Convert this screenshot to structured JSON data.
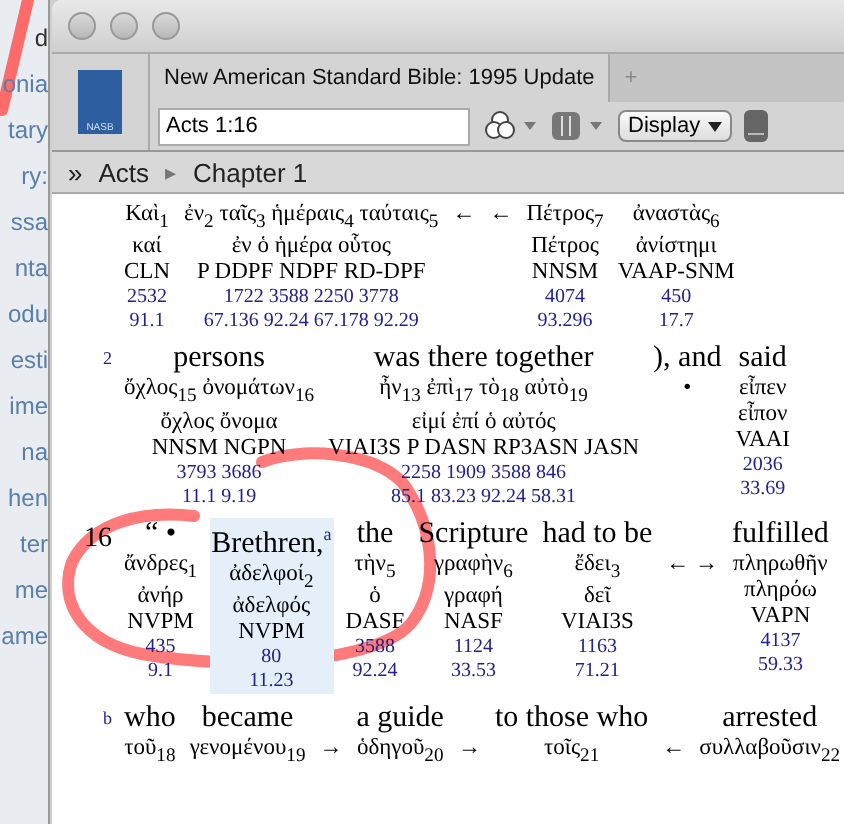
{
  "background_window": {
    "fragments": [
      "d",
      "onia",
      "tary",
      "ry:",
      "ssa",
      "nta",
      "odu",
      "esti",
      "ime",
      "na",
      "hen",
      "ter",
      "me",
      "ame"
    ]
  },
  "toolbar": {
    "logo_text": "NASB",
    "tabs": [
      {
        "label": "New American Standard Bible: 1995 Update",
        "selected": true
      },
      {
        "label": "+",
        "selected": false
      }
    ],
    "reference": "Acts 1:16",
    "display_button": "Display"
  },
  "breadcrumb": {
    "toggle": "»",
    "separator": "▸",
    "items": [
      "Acts",
      "Chapter 1"
    ]
  },
  "lines": [
    {
      "units": [
        {
          "kind": "word",
          "greek": "Καὶ$_{1}$",
          "lemma": "καί",
          "morph": "CLN",
          "strong": "2532",
          "louw": "91.1",
          "selected": false
        },
        {
          "kind": "word",
          "greek": "ἐν$_{2}$ ταῖς$_{3}$ ἡμέραις$_{4}$ ταύταις$_{5}$",
          "lemma": "ἐν ὁ ἡμέρα οὗτος",
          "morph": "P DDPF NDPF RD-DPF",
          "strong": "1722 3588 2250 3778",
          "louw": "67.136 92.24 67.178 92.29",
          "selected": false
        },
        {
          "kind": "arrow",
          "greek": "←"
        },
        {
          "kind": "arrow",
          "greek": "←"
        },
        {
          "kind": "word",
          "greek": "Πέτρος$_{7}$",
          "lemma": "Πέτρος",
          "morph": "NNSM",
          "strong": "4074",
          "louw": "93.296",
          "selected": false
        },
        {
          "kind": "word",
          "greek": "ἀναστὰς$_{6}$",
          "lemma": "ἀνίστημι",
          "morph": "VAAP-SNM",
          "strong": "450",
          "louw": "17.7",
          "selected": false
        }
      ]
    },
    {
      "marker": "2",
      "units": [
        {
          "kind": "word",
          "english": "persons",
          "greek": "ὄχλος$_{15}$ ὀνομάτων$_{16}$",
          "lemma": "ὄχλος ὄνομα",
          "morph": "NNSM NGPN",
          "strong": "3793 3686",
          "louw": "11.1 9.19",
          "selected": false
        },
        {
          "kind": "word",
          "english": "was there together",
          "greek": "ἦν$_{13}$ ἐπὶ$_{17}$ τὸ$_{18}$ αὐτὸ$_{19}$",
          "lemma": "εἰμί ἐπί ὁ αὐτός",
          "morph": "VIAI3S P DASN RP3ASN JASN",
          "strong": "2258 1909 3588 846",
          "louw": "85.1 83.23 92.24 58.31",
          "selected": false
        },
        {
          "kind": "arrow",
          "english": "), and",
          "greek": "•"
        },
        {
          "kind": "word",
          "english": "said",
          "greek": "εἶπεν",
          "lemma": "εἶπον",
          "morph": "VAAI",
          "strong": "2036",
          "louw": "33.69",
          "selected": false
        }
      ]
    },
    {
      "marker": "16",
      "units": [
        {
          "kind": "word",
          "english": "“ •",
          "greek": "ἄνδρες$_{1}$",
          "lemma": "ἀνήρ",
          "morph": "NVPM",
          "strong": "435",
          "louw": "9.1",
          "selected": false
        },
        {
          "kind": "word",
          "english": "Brethren,",
          "note": "a",
          "greek": "ἀδελφοί$_{2}$",
          "lemma": "ἀδελφός",
          "morph": "NVPM",
          "strong": "80",
          "louw": "11.23",
          "selected": true
        },
        {
          "kind": "word",
          "english": "the",
          "greek": "τὴν$_{5}$",
          "lemma": "ὁ",
          "morph": "DASF",
          "strong": "3588",
          "louw": "92.24",
          "selected": false
        },
        {
          "kind": "word",
          "english": "Scripture",
          "greek": "γραφὴν$_{6}$",
          "lemma": "γραφή",
          "morph": "NASF",
          "strong": "1124",
          "louw": "33.53",
          "selected": false
        },
        {
          "kind": "word",
          "english": "had to be",
          "greek": "ἔδει$_{3}$",
          "lemma": "δεῖ",
          "morph": "VIAI3S",
          "strong": "1163",
          "louw": "71.21",
          "selected": false
        },
        {
          "kind": "arrow",
          "greek": "← →"
        },
        {
          "kind": "word",
          "english": "fulfilled",
          "greek": "πληρωθῆν",
          "lemma": "πληρόω",
          "morph": "VAPN",
          "strong": "4137",
          "louw": "59.33",
          "selected": false
        }
      ]
    },
    {
      "marker": "b",
      "units": [
        {
          "kind": "word",
          "english": "who",
          "greek": "τοῦ$_{18}$",
          "selected": false
        },
        {
          "kind": "word",
          "english": "became",
          "greek": "γενομένου$_{19}$",
          "selected": false
        },
        {
          "kind": "arrow",
          "greek": "→"
        },
        {
          "kind": "word",
          "english": "a guide",
          "greek": "ὁδηγοῦ$_{20}$",
          "selected": false
        },
        {
          "kind": "arrow",
          "greek": "→"
        },
        {
          "kind": "word",
          "english": "to those who",
          "greek": "τοῖς$_{21}$",
          "selected": false
        },
        {
          "kind": "arrow",
          "greek": "←"
        },
        {
          "kind": "word",
          "english": "arrested",
          "greek": "συλλαβοῦσιν$_{22}$",
          "selected": false
        }
      ]
    }
  ]
}
